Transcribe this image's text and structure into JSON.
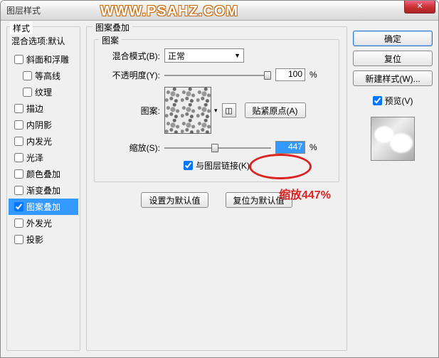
{
  "window": {
    "title": "图层样式"
  },
  "watermark": "WWW.PSAHZ.COM",
  "left": {
    "group_title": "样式",
    "subtitle": "混合选项:默认",
    "items": [
      {
        "label": "斜面和浮雕",
        "checked": false,
        "indented": false,
        "selected": false
      },
      {
        "label": "等高线",
        "checked": false,
        "indented": true,
        "selected": false
      },
      {
        "label": "纹理",
        "checked": false,
        "indented": true,
        "selected": false
      },
      {
        "label": "描边",
        "checked": false,
        "indented": false,
        "selected": false
      },
      {
        "label": "内阴影",
        "checked": false,
        "indented": false,
        "selected": false
      },
      {
        "label": "内发光",
        "checked": false,
        "indented": false,
        "selected": false
      },
      {
        "label": "光泽",
        "checked": false,
        "indented": false,
        "selected": false
      },
      {
        "label": "颜色叠加",
        "checked": false,
        "indented": false,
        "selected": false
      },
      {
        "label": "渐变叠加",
        "checked": false,
        "indented": false,
        "selected": false
      },
      {
        "label": "图案叠加",
        "checked": true,
        "indented": false,
        "selected": true
      },
      {
        "label": "外发光",
        "checked": false,
        "indented": false,
        "selected": false
      },
      {
        "label": "投影",
        "checked": false,
        "indented": false,
        "selected": false
      }
    ]
  },
  "center": {
    "group_title": "图案叠加",
    "inner_title": "图案",
    "blend_mode_label": "混合模式(B):",
    "blend_mode_value": "正常",
    "opacity_label": "不透明度(Y):",
    "opacity_value": "100",
    "percent": "%",
    "pattern_label": "图案:",
    "snap_origin": "贴紧原点(A)",
    "scale_label": "缩放(S):",
    "scale_value": "447",
    "link_label": "与图层链接(K)",
    "set_default": "设置为默认值",
    "reset_default": "复位为默认值",
    "annotation": "缩放447%"
  },
  "right": {
    "ok": "确定",
    "cancel": "复位",
    "new_style": "新建样式(W)...",
    "preview_label": "预览(V)"
  }
}
